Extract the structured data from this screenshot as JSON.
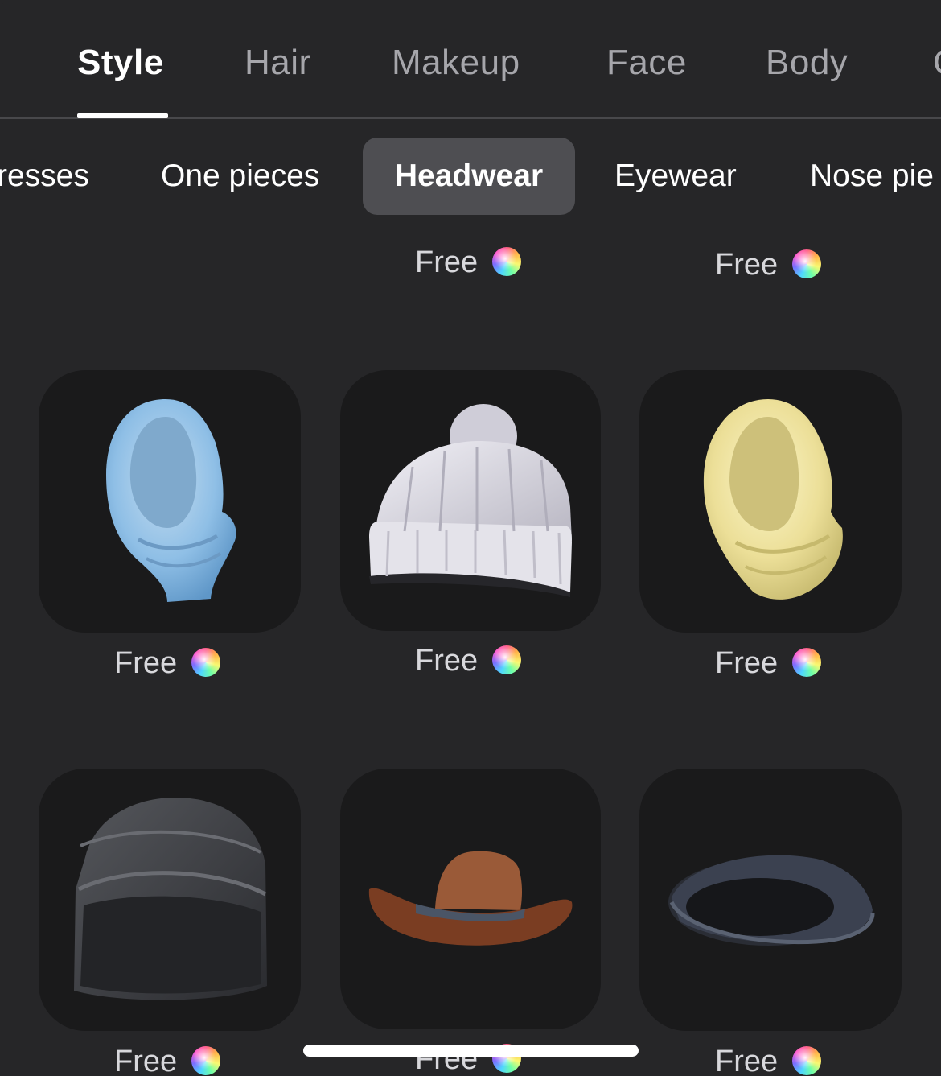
{
  "main_tabs": [
    {
      "label": "Style",
      "active": true
    },
    {
      "label": "Hair",
      "active": false
    },
    {
      "label": "Makeup",
      "active": false
    },
    {
      "label": "Face",
      "active": false
    },
    {
      "label": "Body",
      "active": false
    },
    {
      "label": "C",
      "active": false
    }
  ],
  "categories": [
    {
      "label": "resses",
      "active": false
    },
    {
      "label": "One pieces",
      "active": false
    },
    {
      "label": "Headwear",
      "active": true
    },
    {
      "label": "Eyewear",
      "active": false
    },
    {
      "label": "Nose pie",
      "active": false
    }
  ],
  "items_partial_top": [
    {
      "price": "Free",
      "currency_icon": "rainbow-coin-icon"
    },
    {
      "price": "Free",
      "currency_icon": "rainbow-coin-icon"
    }
  ],
  "items": [
    {
      "name_icon": "blue-hijab-icon",
      "price": "Free",
      "currency_icon": "rainbow-coin-icon"
    },
    {
      "name_icon": "white-knit-beanie-icon",
      "price": "Free",
      "currency_icon": "rainbow-coin-icon"
    },
    {
      "name_icon": "yellow-hijab-icon",
      "price": "Free",
      "currency_icon": "rainbow-coin-icon"
    },
    {
      "name_icon": "black-head-wrap-icon",
      "price": "Free",
      "currency_icon": "rainbow-coin-icon"
    },
    {
      "name_icon": "brown-cowboy-hat-icon",
      "price": "Free",
      "currency_icon": "rainbow-coin-icon"
    },
    {
      "name_icon": "black-flat-cap-icon",
      "price": "Free",
      "currency_icon": "rainbow-coin-icon"
    }
  ],
  "colors": {
    "background": "#262628",
    "card": "#1a1a1b",
    "active_chip": "#4e4e52",
    "inactive_tab_text": "#a6a6ab",
    "active_text": "#ffffff"
  }
}
